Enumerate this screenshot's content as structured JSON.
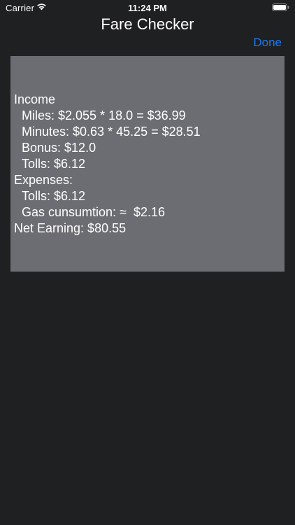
{
  "status_bar": {
    "carrier": "Carrier",
    "time": "11:24 PM"
  },
  "nav": {
    "title": "Fare Checker",
    "done_label": "Done"
  },
  "colors": {
    "background": "#1f2022",
    "panel": "#6c6d72",
    "accent": "#1a7bf0",
    "text": "#ffffff"
  },
  "result": {
    "income_header": "Income",
    "miles": "Miles: $2.055 * 18.0 = $36.99",
    "minutes": "Minutes: $0.63 * 45.25 = $28.51",
    "bonus": "Bonus: $12.0",
    "income_tolls": "Tolls: $6.12",
    "expenses_header": "Expenses:",
    "expense_tolls": "Tolls: $6.12",
    "gas": "Gas cunsumtion: ≈  $2.16",
    "net": "Net Earning: $80.55"
  }
}
